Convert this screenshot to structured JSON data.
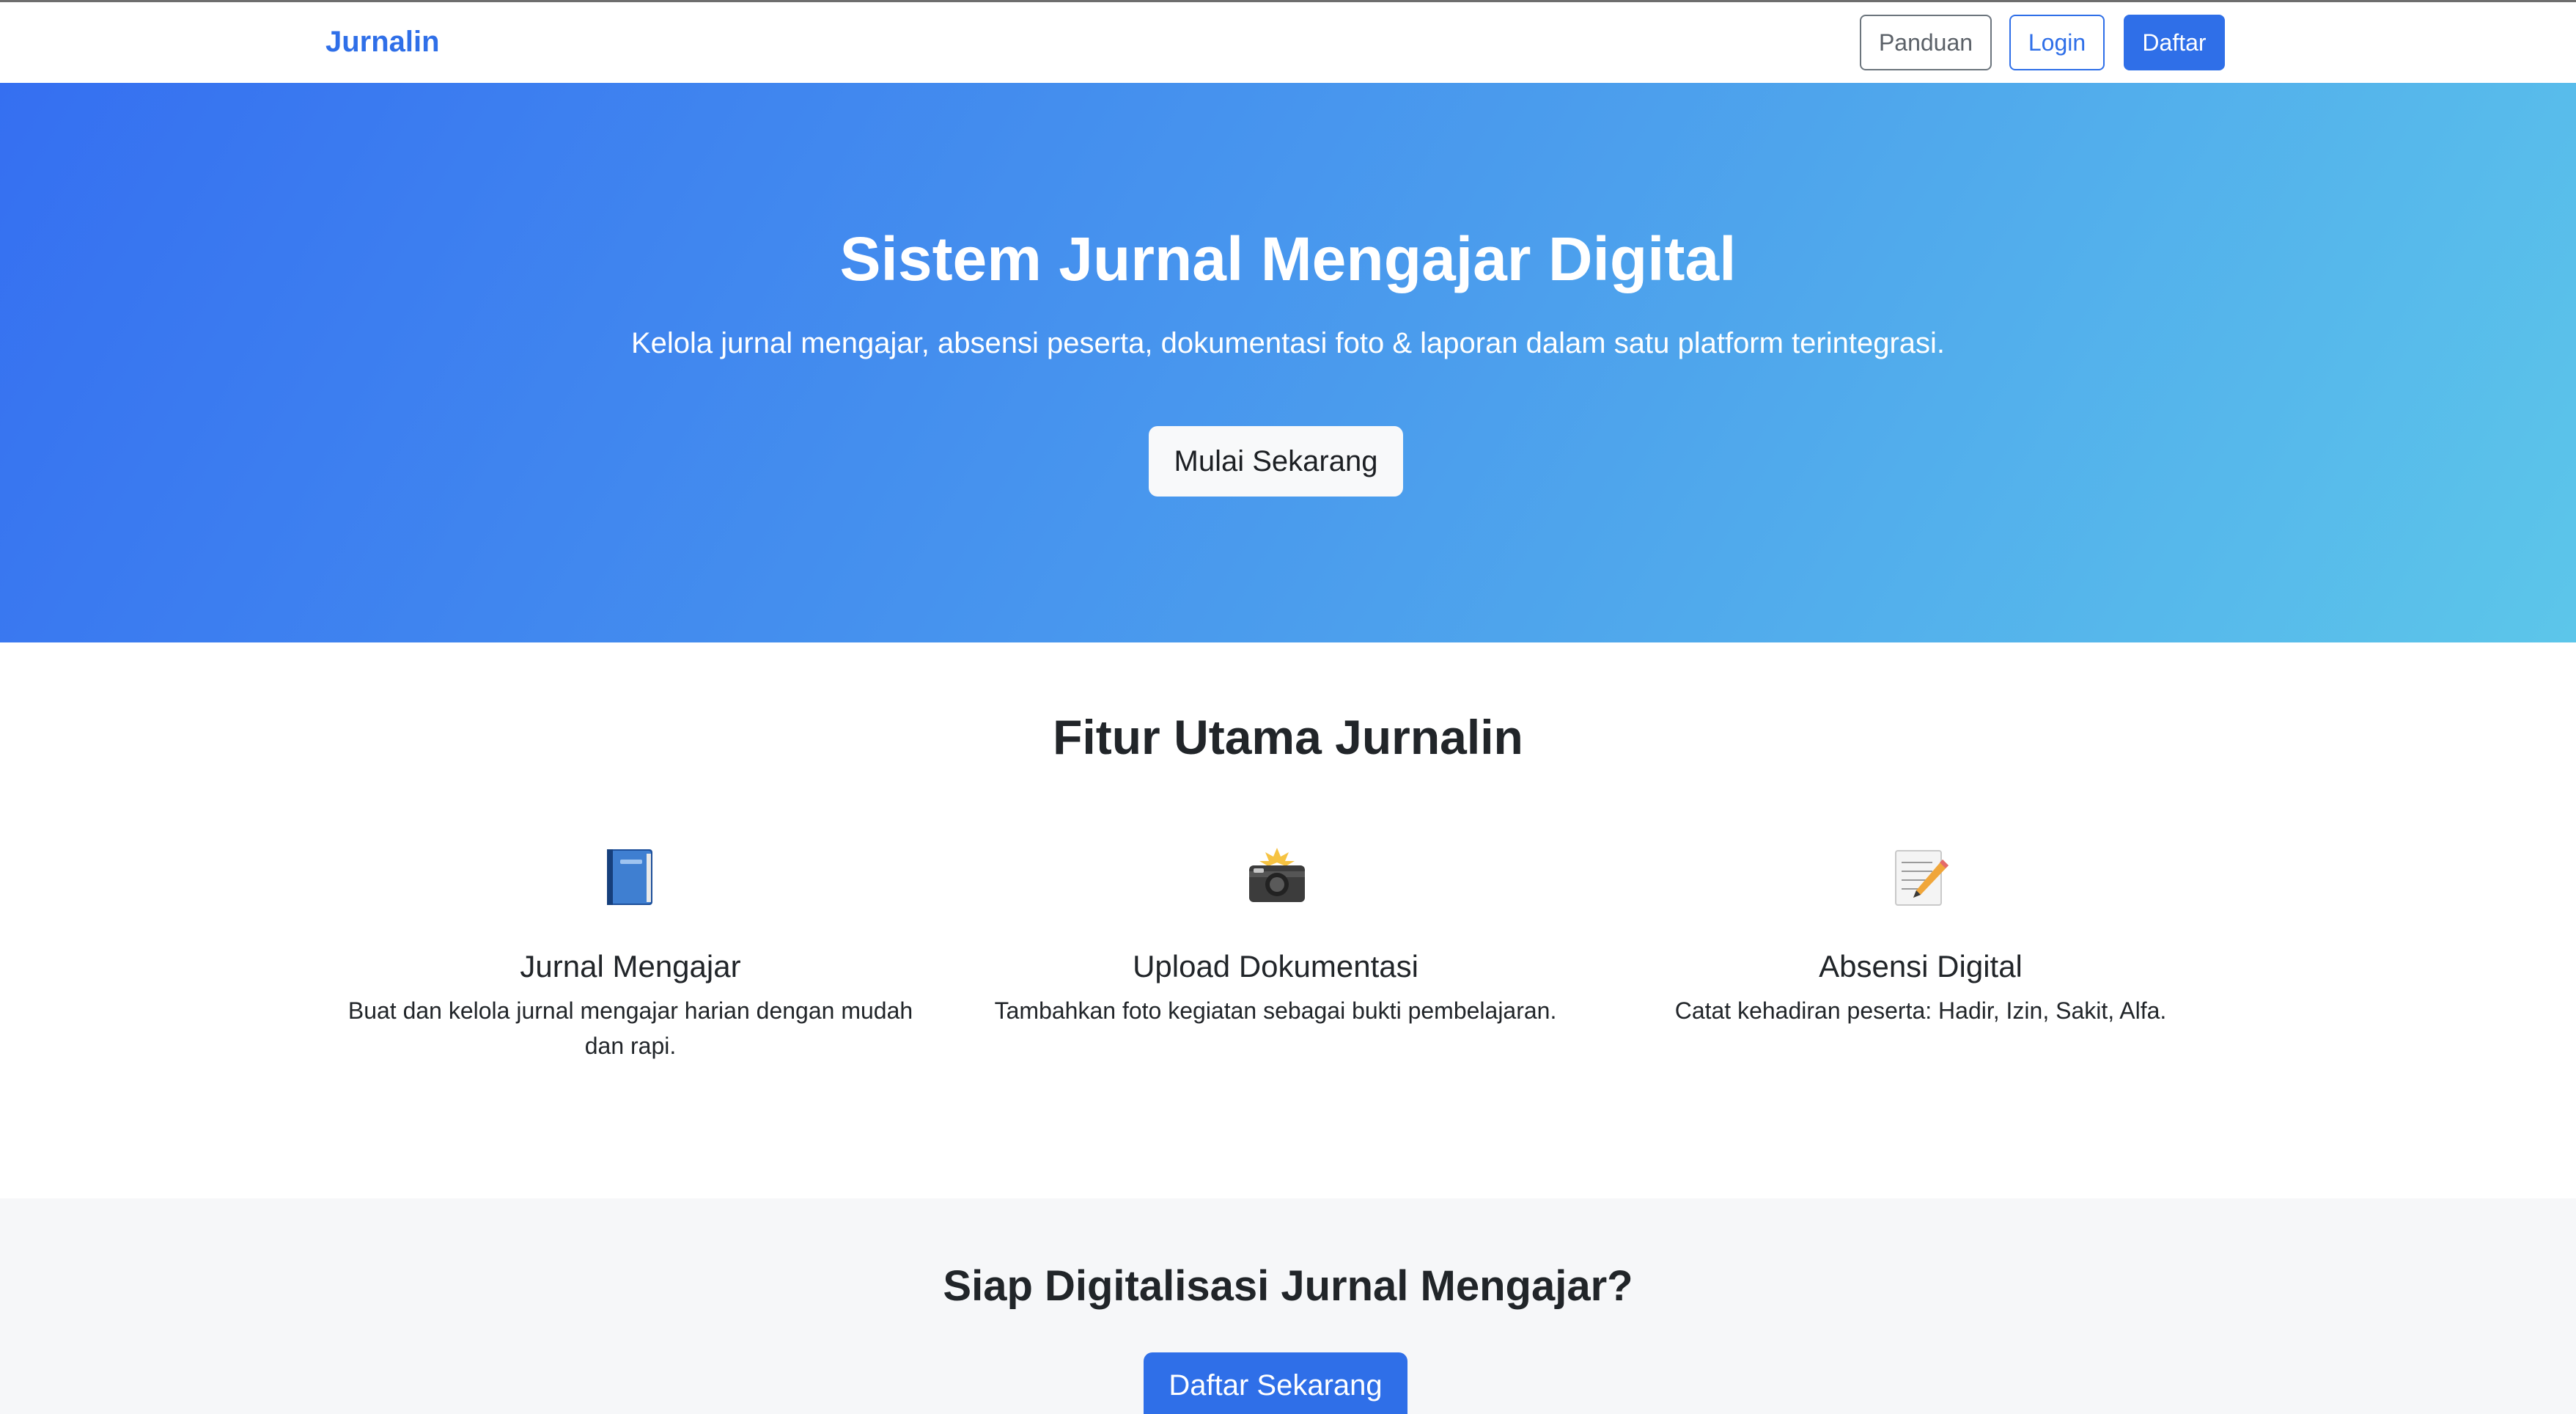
{
  "navbar": {
    "brand": "Jurnalin",
    "buttons": {
      "panduan": "Panduan",
      "login": "Login",
      "daftar": "Daftar"
    }
  },
  "hero": {
    "title": "Sistem Jurnal Mengajar Digital",
    "subtitle": "Kelola jurnal mengajar, absensi peserta, dokumentasi foto & laporan dalam satu platform terintegrasi.",
    "cta_label": "Mulai Sekarang"
  },
  "features": {
    "title": "Fitur Utama Jurnalin",
    "items": [
      {
        "icon": "book-icon",
        "title": "Jurnal Mengajar",
        "description": "Buat dan kelola jurnal mengajar harian dengan mudah dan rapi."
      },
      {
        "icon": "camera-flash-icon",
        "title": "Upload Dokumentasi",
        "description": "Tambahkan foto kegiatan sebagai bukti pembelajaran."
      },
      {
        "icon": "memo-pencil-icon",
        "title": "Absensi Digital",
        "description": "Catat kehadiran peserta: Hadir, Izin, Sakit, Alfa."
      }
    ]
  },
  "cta": {
    "title": "Siap Digitalisasi Jurnal Mengajar?",
    "button_label": "Daftar Sekarang"
  },
  "colors": {
    "primary": "#2f6fe8",
    "hero_gradient_start": "#356ff1",
    "hero_gradient_end": "#5cc6ea",
    "text_dark": "#212529",
    "section_light": "#f6f7f9"
  }
}
